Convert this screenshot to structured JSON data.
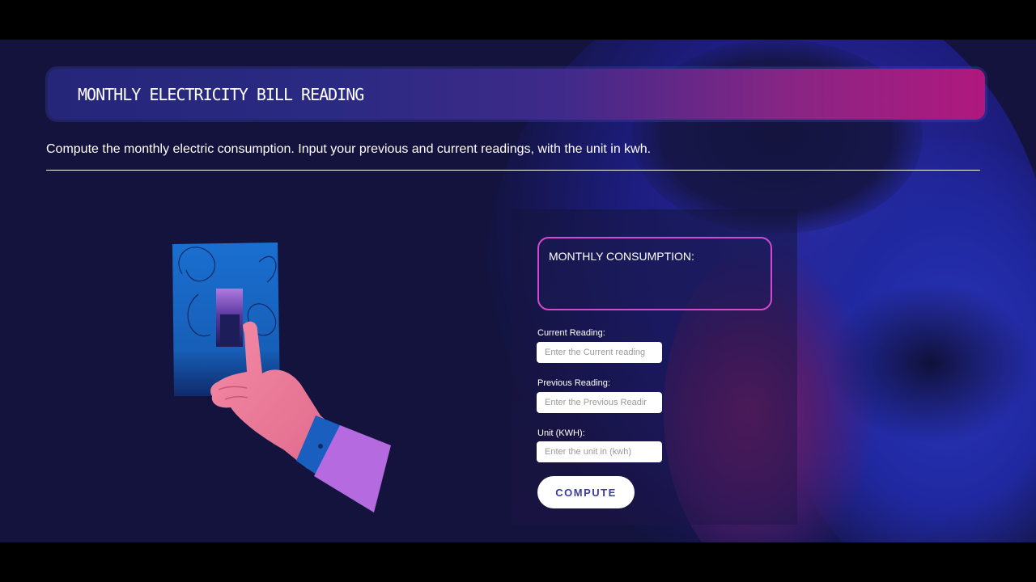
{
  "header": {
    "title": "MONTHLY ELECTRICITY BILL READING",
    "subtitle": "Compute the monthly electric consumption. Input your previous and current readings, with the unit in kwh."
  },
  "illustration": {
    "icon": "hand-flipping-light-switch-illustration"
  },
  "result": {
    "label": "MONTHLY CONSUMPTION:",
    "value": ""
  },
  "form": {
    "current": {
      "label": "Current Reading:",
      "value": "",
      "placeholder": "Enter the Current reading"
    },
    "previous": {
      "label": "Previous Reading:",
      "value": "",
      "placeholder": "Enter the Previous Readir"
    },
    "unit": {
      "label": "Unit (KWH):",
      "value": "",
      "placeholder": "Enter the unit in (kwh)"
    },
    "compute_label": "COMPUTE"
  },
  "colors": {
    "background": "#13133d",
    "title_gradient_start": "#25257a",
    "title_gradient_end": "#b0187e",
    "result_border": "#d14bd0",
    "button_text": "#3b3ba0",
    "switch_plate": "#1a6fd0",
    "hand": "#f07f9a",
    "sleeve": "#b56ae0"
  }
}
